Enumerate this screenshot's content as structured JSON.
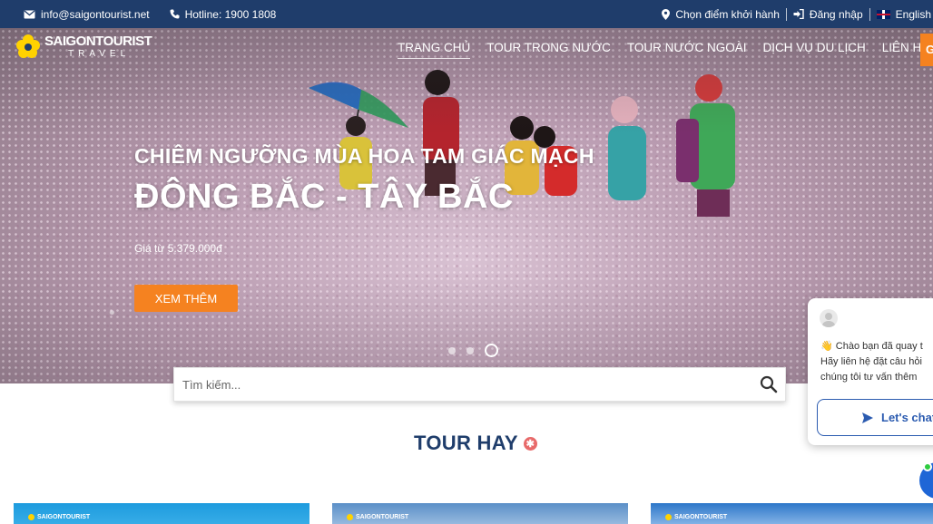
{
  "topbar": {
    "email": "info@saigontourist.net",
    "hotline": "Hotline: 1900 1808",
    "choose_departure": "Chọn điểm khởi hành",
    "login": "Đăng nhập",
    "language": "English"
  },
  "logo": {
    "brand": "SAIGONTOURIST",
    "sub": "TRAVEL"
  },
  "nav": {
    "items": [
      "TRANG CHỦ",
      "TOUR TRONG NƯỚC",
      "TOUR NƯỚC NGOÀI",
      "DỊCH VỤ DU LỊCH",
      "LIÊN HỆ"
    ],
    "cta_fragment": "G"
  },
  "hero": {
    "subtitle": "CHIÊM NGƯỠNG MÙA HOA TAM GIÁC MẠCH",
    "title": "ĐÔNG BẮC - TÂY BẮC",
    "price": "Giá từ 5.379.000đ",
    "button": "XEM THÊM",
    "slides_count": 3,
    "active_slide": 3
  },
  "search": {
    "placeholder": "Tìm kiếm..."
  },
  "section": {
    "title": "TOUR HAY"
  },
  "cards": [
    {
      "logo": "SAIGONTOURIST"
    },
    {
      "logo": "SAIGONTOURIST"
    },
    {
      "logo": "SAIGONTOURIST"
    }
  ],
  "chat": {
    "line1": "Chào bạn đã quay t",
    "line2": "Hãy liên hệ đặt câu hỏi",
    "line3": "chúng tôi tư vấn thêm",
    "button": "Let's chat"
  },
  "colors": {
    "topbar": "#1f3d6b",
    "accent_orange": "#f58220",
    "section_title": "#1f3d6b",
    "chat_blue": "#2b5bb0"
  }
}
